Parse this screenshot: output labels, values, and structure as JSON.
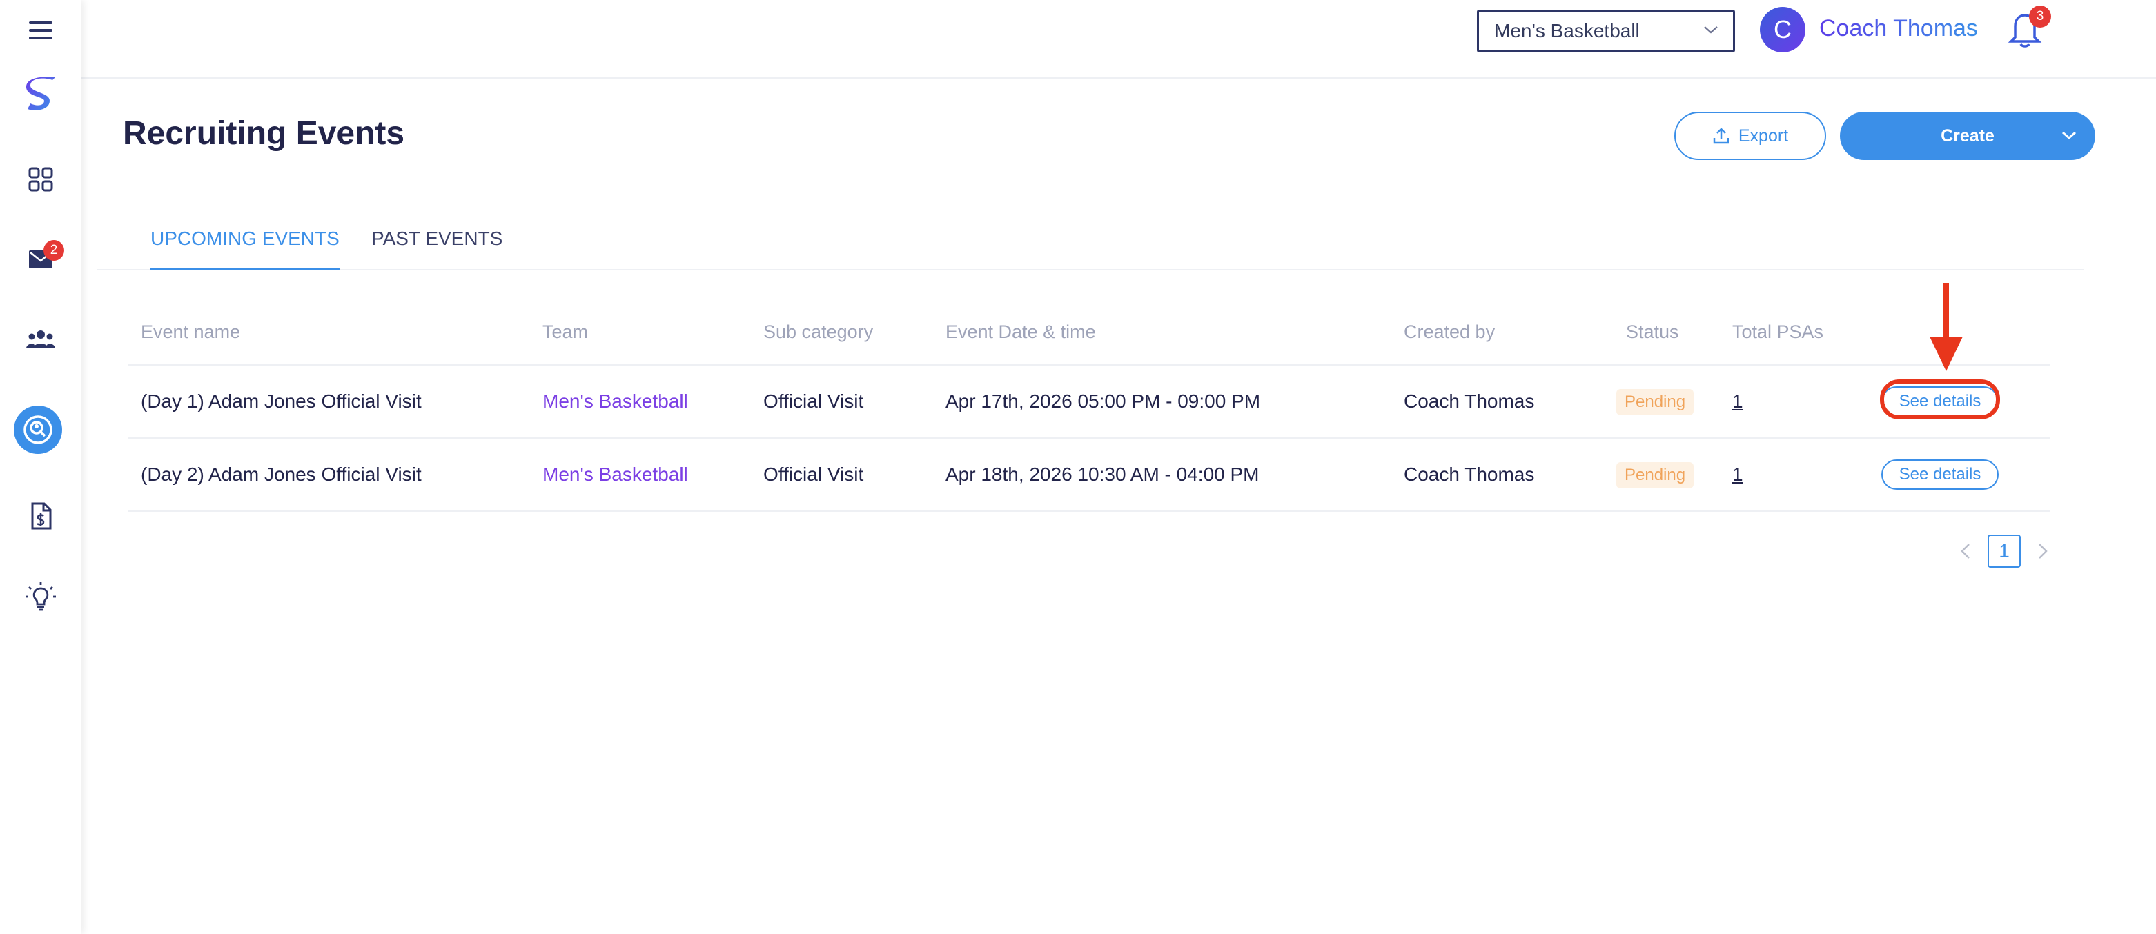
{
  "sidebar": {
    "badge_messages": "2",
    "icons": [
      "menu-icon",
      "logo-icon",
      "dashboard-icon",
      "mail-icon",
      "team-icon",
      "search-user-icon",
      "document-icon",
      "lightbulb-icon"
    ]
  },
  "topbar": {
    "team_selected": "Men's Basketball",
    "avatar_initial": "C",
    "user_name": "Coach Thomas",
    "notification_count": "3"
  },
  "page": {
    "title": "Recruiting Events",
    "export_label": "Export",
    "create_label": "Create"
  },
  "tabs": {
    "upcoming": "UPCOMING EVENTS",
    "past": "PAST EVENTS"
  },
  "table": {
    "headers": {
      "event_name": "Event name",
      "team": "Team",
      "sub_category": "Sub category",
      "date_time": "Event Date & time",
      "created_by": "Created by",
      "status": "Status",
      "total_psas": "Total PSAs"
    },
    "rows": [
      {
        "event_name": "(Day 1) Adam Jones Official Visit",
        "team": "Men's Basketball",
        "sub_category": "Official Visit",
        "date_time": "Apr 17th, 2026 05:00 PM - 09:00 PM",
        "created_by": "Coach Thomas",
        "status": "Pending",
        "total_psas": "1",
        "action": "See details"
      },
      {
        "event_name": "(Day 2) Adam Jones Official Visit",
        "team": "Men's Basketball",
        "sub_category": "Official Visit",
        "date_time": "Apr 18th, 2026 10:30 AM - 04:00 PM",
        "created_by": "Coach Thomas",
        "status": "Pending",
        "total_psas": "1",
        "action": "See details"
      }
    ]
  },
  "pagination": {
    "current_page": "1"
  },
  "colors": {
    "accent": "#3b8fe8",
    "team_link": "#7b3fe4",
    "status_pending": "#f0a35a",
    "annotation": "#e8361c"
  }
}
